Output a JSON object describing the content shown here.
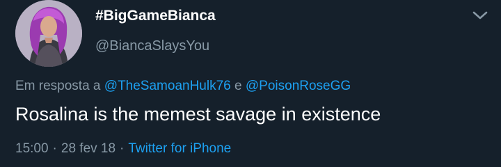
{
  "user": {
    "display_name": "#BigGameBianca",
    "handle": "@BiancaSlaysYou",
    "avatar_icon": "profile-photo"
  },
  "menu": {
    "icon": "chevron-down-icon"
  },
  "reply": {
    "prefix": "Em resposta a",
    "mention_1": "@TheSamoanHulk76",
    "conjunction": "e",
    "mention_2": "@PoisonRoseGG"
  },
  "tweet": {
    "text": "Rosalina is the memest savage in existence"
  },
  "meta": {
    "time": "15:00",
    "separator": "·",
    "date": "28 fev 18",
    "source": "Twitter for iPhone"
  },
  "colors": {
    "background": "#15202b",
    "primary_text": "#ffffff",
    "secondary_text": "#8899a6",
    "accent": "#1da1f2"
  }
}
